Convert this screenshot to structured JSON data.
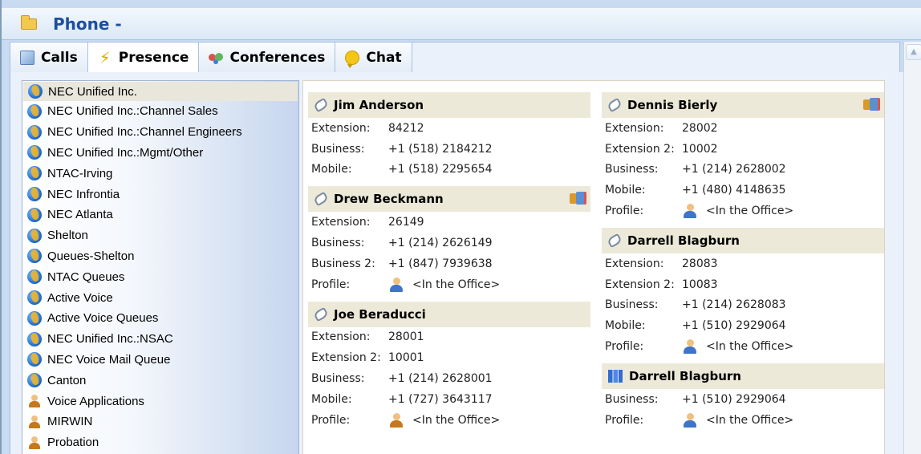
{
  "window": {
    "title": "Phone -"
  },
  "tabs": [
    {
      "label": "Calls",
      "icon": "calls-icon"
    },
    {
      "label": "Presence",
      "icon": "lightning-icon",
      "active": true
    },
    {
      "label": "Conferences",
      "icon": "conference-icon"
    },
    {
      "label": "Chat",
      "icon": "chat-bubble-icon"
    }
  ],
  "groups": [
    {
      "label": "NEC Unified Inc.",
      "icon": "globe-icon",
      "selected": true
    },
    {
      "label": "NEC Unified Inc.:Channel Sales",
      "icon": "globe-icon"
    },
    {
      "label": "NEC Unified Inc.:Channel Engineers",
      "icon": "globe-icon"
    },
    {
      "label": "NEC Unified Inc.:Mgmt/Other",
      "icon": "globe-icon"
    },
    {
      "label": "NTAC-Irving",
      "icon": "globe-icon"
    },
    {
      "label": "NEC Infrontia",
      "icon": "globe-icon"
    },
    {
      "label": "NEC Atlanta",
      "icon": "globe-icon"
    },
    {
      "label": "Shelton",
      "icon": "globe-icon"
    },
    {
      "label": "Queues-Shelton",
      "icon": "globe-icon"
    },
    {
      "label": "NTAC Queues",
      "icon": "globe-icon"
    },
    {
      "label": "Active Voice",
      "icon": "globe-icon"
    },
    {
      "label": "Active Voice Queues",
      "icon": "globe-icon"
    },
    {
      "label": "NEC Unified Inc.:NSAC",
      "icon": "globe-icon"
    },
    {
      "label": "NEC Voice Mail Queue",
      "icon": "globe-icon"
    },
    {
      "label": "Canton",
      "icon": "globe-icon"
    },
    {
      "label": "Voice Applications",
      "icon": "person-icon"
    },
    {
      "label": "MIRWIN",
      "icon": "person-icon"
    },
    {
      "label": "Probation",
      "icon": "person-icon"
    }
  ],
  "contacts_left": [
    {
      "name": "Jim Anderson",
      "icon": "phone-icon",
      "status_icon": false,
      "rows": [
        {
          "label": "Extension:",
          "value": "84212"
        },
        {
          "label": "Business:",
          "value": "+1 (518) 2184212"
        },
        {
          "label": "Mobile:",
          "value": "+1 (518) 2295654"
        }
      ]
    },
    {
      "name": "Drew Beckmann",
      "icon": "phone-icon",
      "status_icon": true,
      "rows": [
        {
          "label": "Extension:",
          "value": "26149"
        },
        {
          "label": "Business:",
          "value": "+1 (214) 2626149"
        },
        {
          "label": "Business 2:",
          "value": "+1 (847) 7939638"
        },
        {
          "label": "Profile:",
          "value": "<In the Office>",
          "profile": true
        }
      ]
    },
    {
      "name": "Joe Beraducci",
      "icon": "phone-icon",
      "status_icon": false,
      "rows": [
        {
          "label": "Extension:",
          "value": "28001"
        },
        {
          "label": "Extension 2:",
          "value": "10001"
        },
        {
          "label": "Business:",
          "value": "+1 (214) 2628001"
        },
        {
          "label": "Mobile:",
          "value": "+1 (727) 3643117"
        },
        {
          "label": "Profile:",
          "value": "<In the Office>",
          "profile": true,
          "busy": true
        }
      ]
    }
  ],
  "contacts_right": [
    {
      "name": "Dennis Bierly",
      "icon": "phone-icon",
      "status_icon": true,
      "rows": [
        {
          "label": "Extension:",
          "value": "28002"
        },
        {
          "label": "Extension 2:",
          "value": "10002"
        },
        {
          "label": "Business:",
          "value": "+1 (214) 2628002"
        },
        {
          "label": "Mobile:",
          "value": "+1 (480) 4148635"
        },
        {
          "label": "Profile:",
          "value": "<In the Office>",
          "profile": true
        }
      ]
    },
    {
      "name": "Darrell Blagburn",
      "icon": "phone-icon",
      "status_icon": false,
      "rows": [
        {
          "label": "Extension:",
          "value": "28083"
        },
        {
          "label": "Extension 2:",
          "value": "10083"
        },
        {
          "label": "Business:",
          "value": "+1 (214) 2628083"
        },
        {
          "label": "Mobile:",
          "value": "+1 (510) 2929064"
        },
        {
          "label": "Profile:",
          "value": "<In the Office>",
          "profile": true
        }
      ]
    },
    {
      "name": "Darrell Blagburn",
      "icon": "building-icon",
      "status_icon": false,
      "rows": [
        {
          "label": "Business:",
          "value": "+1 (510) 2929064"
        },
        {
          "label": "Profile:",
          "value": "<In the Office>",
          "profile": true
        }
      ]
    }
  ]
}
